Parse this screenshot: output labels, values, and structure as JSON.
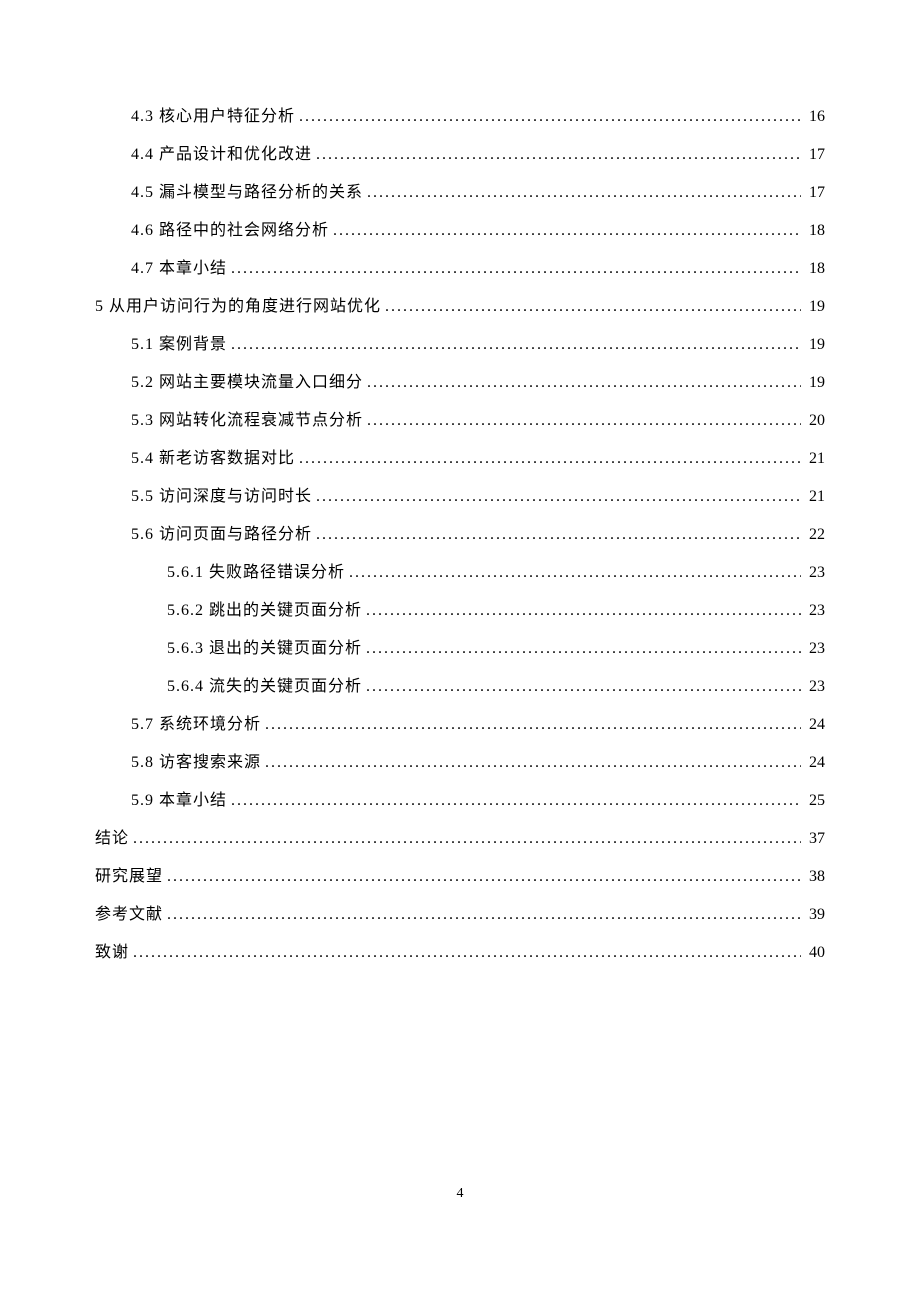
{
  "toc": [
    {
      "level": 1,
      "title": "4.3 核心用户特征分析",
      "page": "16"
    },
    {
      "level": 1,
      "title": "4.4 产品设计和优化改进",
      "page": "17"
    },
    {
      "level": 1,
      "title": "4.5 漏斗模型与路径分析的关系",
      "page": "17"
    },
    {
      "level": 1,
      "title": "4.6 路径中的社会网络分析",
      "page": "18"
    },
    {
      "level": 1,
      "title": "4.7 本章小结",
      "page": "18"
    },
    {
      "level": 0,
      "title": "5 从用户访问行为的角度进行网站优化",
      "page": "19"
    },
    {
      "level": 1,
      "title": "5.1 案例背景",
      "page": "19"
    },
    {
      "level": 1,
      "title": "5.2 网站主要模块流量入口细分",
      "page": "19"
    },
    {
      "level": 1,
      "title": "5.3 网站转化流程衰减节点分析",
      "page": "20"
    },
    {
      "level": 1,
      "title": "5.4 新老访客数据对比",
      "page": "21"
    },
    {
      "level": 1,
      "title": "5.5 访问深度与访问时长",
      "page": "21"
    },
    {
      "level": 1,
      "title": "5.6 访问页面与路径分析",
      "page": "22"
    },
    {
      "level": 2,
      "title": "5.6.1 失败路径错误分析",
      "page": "23"
    },
    {
      "level": 2,
      "title": "5.6.2 跳出的关键页面分析",
      "page": "23"
    },
    {
      "level": 2,
      "title": "5.6.3 退出的关键页面分析",
      "page": "23"
    },
    {
      "level": 2,
      "title": "5.6.4 流失的关键页面分析",
      "page": "23"
    },
    {
      "level": 1,
      "title": "5.7 系统环境分析",
      "page": "24"
    },
    {
      "level": 1,
      "title": "5.8 访客搜索来源",
      "page": "24"
    },
    {
      "level": 1,
      "title": "5.9 本章小结",
      "page": "25"
    },
    {
      "level": 0,
      "title": "结论",
      "page": "37"
    },
    {
      "level": 0,
      "title": "研究展望",
      "page": "38"
    },
    {
      "level": 0,
      "title": "参考文献",
      "page": "39"
    },
    {
      "level": 0,
      "title": "致谢",
      "page": "40"
    }
  ],
  "pageNumber": "4"
}
